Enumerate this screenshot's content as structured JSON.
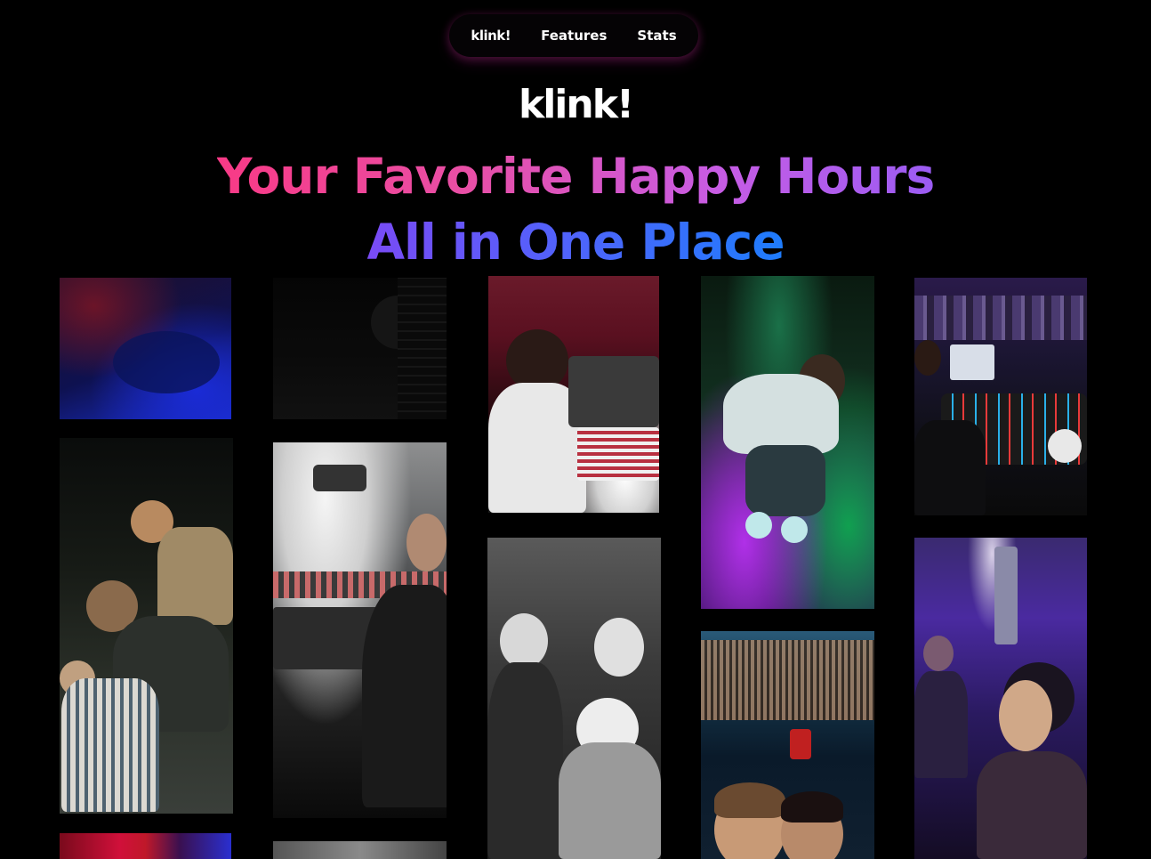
{
  "nav": {
    "logo": "klink!",
    "links": [
      "Features",
      "Stats"
    ]
  },
  "hero": {
    "brand": "klink!",
    "headline_line1": "Your Favorite Happy Hours",
    "headline_line2": "All in One Place"
  },
  "colors": {
    "background": "#000000",
    "headline_gradient_1": [
      "#f83a86",
      "#9b5cf3"
    ],
    "headline_gradient_2": [
      "#7a4bf5",
      "#1e7cfc"
    ]
  },
  "gallery": {
    "photos": [
      "dark club crowd red and blue lights",
      "people dancing in dark club",
      "crowd at party with tinted lighting",
      "red and blue stage lights",
      "very dark club interior",
      "dj at mixer with crowd in white light",
      "black and white club scene",
      "dj playing records at red booth",
      "black and white friends laughing on dance floor",
      "person dancing in green and purple light",
      "friends smiling under club ceiling",
      "dj decks with crowd in background",
      "crowd under purple light"
    ]
  }
}
